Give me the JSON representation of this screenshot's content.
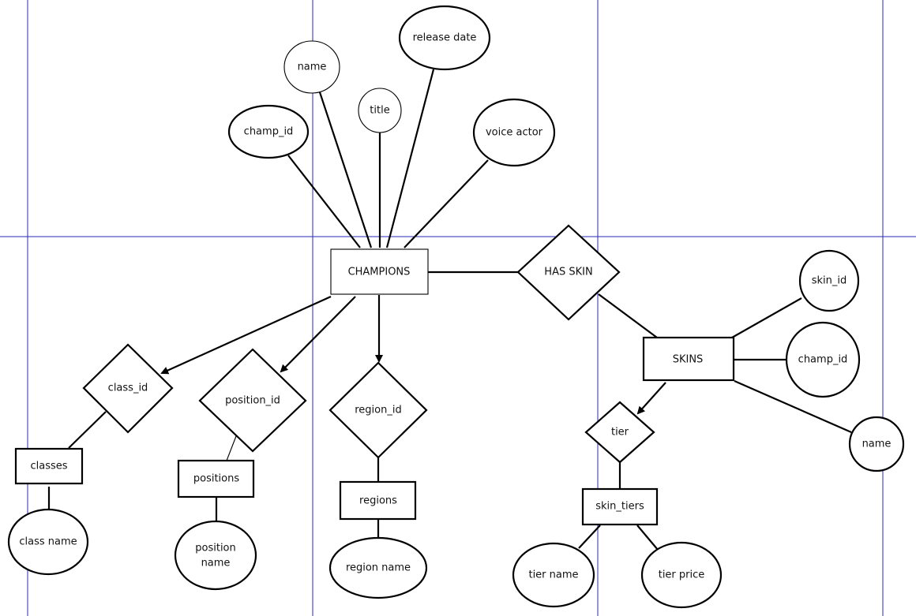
{
  "colors": {
    "grid": "#2a2ab8",
    "stroke": "#000000",
    "background": "#ffffff"
  },
  "entities": {
    "champions": "CHAMPIONS",
    "skins": "SKINS",
    "classes": "classes",
    "positions": "positions",
    "regions": "regions",
    "skin_tiers": "skin_tiers"
  },
  "relationships": {
    "has_skin": "HAS SKIN",
    "class_id": "class_id",
    "position_id": "position_id",
    "region_id": "region_id",
    "tier": "tier"
  },
  "attributes": {
    "champ_id": "champ_id",
    "name": "name",
    "title": "title",
    "release_date": "release date",
    "voice_actor": "voice actor",
    "skin_id": "skin_id",
    "skin_champ_id": "champ_id",
    "skin_name": "name",
    "class_name": "class name",
    "position_name_1": "position",
    "position_name_2": "name",
    "region_name": "region name",
    "tier_name": "tier name",
    "tier_price": "tier price"
  }
}
